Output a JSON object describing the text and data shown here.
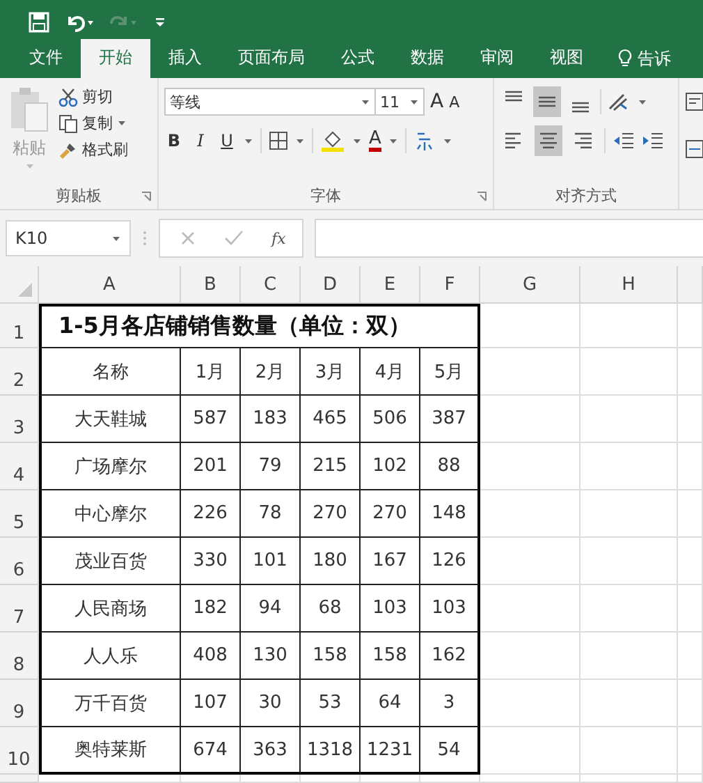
{
  "tabs": [
    {
      "label": "文件",
      "selected": false
    },
    {
      "label": "开始",
      "selected": true
    },
    {
      "label": "插入",
      "selected": false
    },
    {
      "label": "页面布局",
      "selected": false
    },
    {
      "label": "公式",
      "selected": false
    },
    {
      "label": "数据",
      "selected": false
    },
    {
      "label": "审阅",
      "selected": false
    },
    {
      "label": "视图",
      "selected": false
    }
  ],
  "tell_me": {
    "label": "告诉"
  },
  "ribbon": {
    "clipboard": {
      "label": "剪贴板",
      "paste": "粘贴",
      "cut": "剪切",
      "copy": "复制",
      "format_painter": "格式刷"
    },
    "font": {
      "label": "字体",
      "font_name": "等线",
      "font_size": "11",
      "grow": "A",
      "shrink": "A",
      "bold": "B",
      "italic": "I",
      "underline": "U",
      "font_color": "A"
    },
    "alignment": {
      "label": "对齐方式",
      "vertical": [
        {
          "kind": "top",
          "selected": false
        },
        {
          "kind": "middle",
          "selected": true
        },
        {
          "kind": "bottom",
          "selected": false
        }
      ],
      "horizontal": [
        {
          "kind": "left",
          "selected": false
        },
        {
          "kind": "center",
          "selected": true
        },
        {
          "kind": "right",
          "selected": false
        }
      ]
    }
  },
  "formula_bar": {
    "name_box": "K10",
    "function_label": "fx"
  },
  "sheet": {
    "columns": [
      "A",
      "B",
      "C",
      "D",
      "E",
      "F",
      "G",
      "H"
    ],
    "row_headers": [
      "1",
      "2",
      "3",
      "4",
      "5",
      "6",
      "7",
      "8",
      "9",
      "10"
    ],
    "title": "1-5月各店铺销售数量（单位：双）",
    "header": [
      "名称",
      "1月",
      "2月",
      "3月",
      "4月",
      "5月"
    ],
    "rows": [
      [
        "大天鞋城",
        "587",
        "183",
        "465",
        "506",
        "387"
      ],
      [
        "广场摩尔",
        "201",
        "79",
        "215",
        "102",
        "88"
      ],
      [
        "中心摩尔",
        "226",
        "78",
        "270",
        "270",
        "148"
      ],
      [
        "茂业百货",
        "330",
        "101",
        "180",
        "167",
        "126"
      ],
      [
        "人民商场",
        "182",
        "94",
        "68",
        "103",
        "103"
      ],
      [
        "人人乐",
        "408",
        "130",
        "158",
        "158",
        "162"
      ],
      [
        "万千百货",
        "107",
        "30",
        "53",
        "64",
        "3"
      ],
      [
        "奥特莱斯",
        "674",
        "363",
        "1318",
        "1231",
        "54"
      ]
    ]
  }
}
